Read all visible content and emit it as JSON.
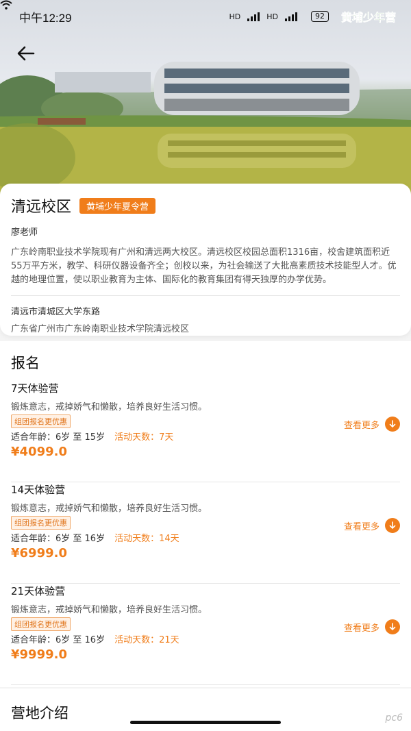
{
  "status_bar": {
    "time": "中午12:29",
    "net1": "HD",
    "net2": "HD",
    "battery": "92",
    "app_logo": "黄埔少年营"
  },
  "campus": {
    "name": "清远校区",
    "tag": "黄埔少年夏令营",
    "teacher": "廖老师",
    "description": "广东岭南职业技术学院现有广州和清远两大校区。清远校区校园总面积1316亩，校舍建筑面积近55万平方米，教学、科研仪器设备齐全；创校以来，为社会输送了大批高素质技术技能型人才。优越的地理位置，使以职业教育为主体、国际化的教育集团有得天独厚的办学优势。",
    "address_line1": "清远市清城区大学东路",
    "address_line2": "广东省广州市广东岭南职业技术学院清远校区"
  },
  "signup": {
    "title": "报名",
    "camps": [
      {
        "name": "7天体验营",
        "desc": "锻炼意志，戒掉娇气和懒散，培养良好生活习惯。",
        "promo": "组团报名更优惠",
        "age": "适合年龄：6岁 至 15岁",
        "days": "活动天数：7天",
        "price": "¥4099.0",
        "more": "查看更多"
      },
      {
        "name": "14天体验营",
        "desc": "锻炼意志，戒掉娇气和懒散，培养良好生活习惯。",
        "promo": "组团报名更优惠",
        "age": "适合年龄：6岁 至 16岁",
        "days": "活动天数：14天",
        "price": "¥6999.0",
        "more": "查看更多"
      },
      {
        "name": "21天体验营",
        "desc": "锻炼意志，戒掉娇气和懒散，培养良好生活习惯。",
        "promo": "组团报名更优惠",
        "age": "适合年龄：6岁 至 16岁",
        "days": "活动天数：21天",
        "price": "¥9999.0",
        "more": "查看更多"
      }
    ]
  },
  "intro": {
    "title": "营地介绍"
  },
  "watermark": "pc6",
  "colors": {
    "accent": "#f07d1a"
  },
  "icons": {
    "back": "arrow-left-icon",
    "more": "arrow-down-circle-icon"
  }
}
